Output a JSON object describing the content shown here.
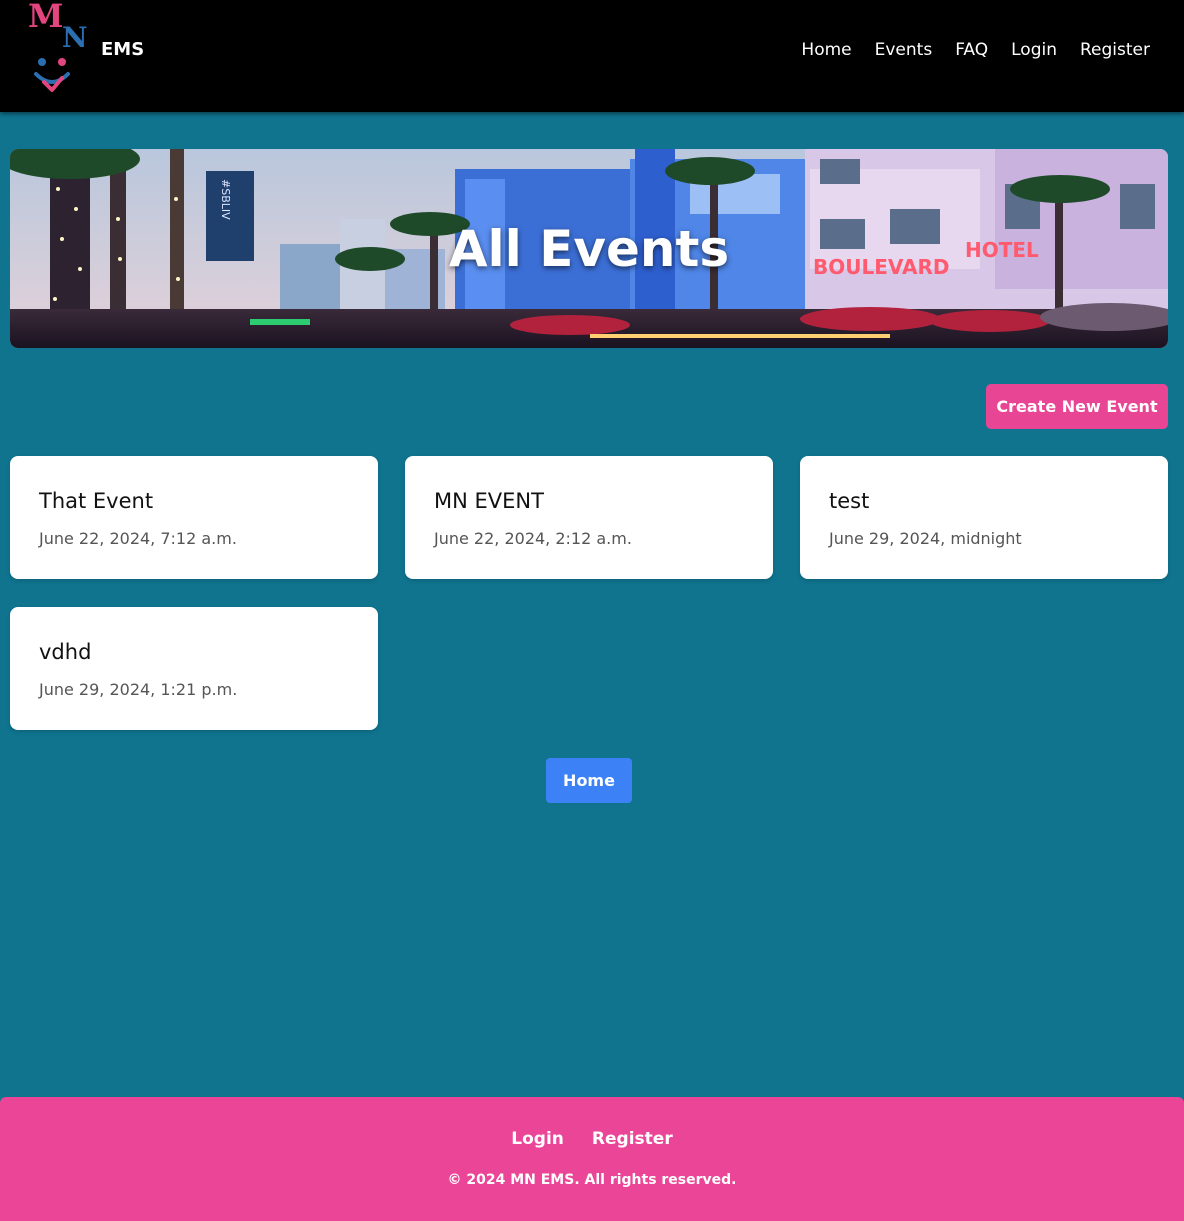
{
  "navbar": {
    "logo_letters": [
      "M",
      "N"
    ],
    "brand": "EMS",
    "links": [
      "Home",
      "Events",
      "FAQ",
      "Login",
      "Register"
    ]
  },
  "hero": {
    "title": "All Events",
    "sign_left": "#SBLIV",
    "sign_boulevard": "BOULEVARD",
    "sign_hotel": "HOTEL"
  },
  "actions": {
    "create_label": "Create New Event",
    "home_label": "Home"
  },
  "events": [
    {
      "title": "That Event",
      "date": "June 22, 2024, 7:12 a.m."
    },
    {
      "title": "MN EVENT",
      "date": "June 22, 2024, 2:12 a.m."
    },
    {
      "title": "test",
      "date": "June 29, 2024, midnight"
    },
    {
      "title": "vdhd",
      "date": "June 29, 2024, 1:21 p.m."
    }
  ],
  "footer": {
    "links": [
      "Login",
      "Register"
    ],
    "copyright": "© 2024 MN EMS. All rights reserved."
  },
  "colors": {
    "background": "#10748f",
    "navbar": "#000000",
    "accent_pink": "#e94595",
    "button_blue": "#3c82f6",
    "card": "#ffffff"
  }
}
